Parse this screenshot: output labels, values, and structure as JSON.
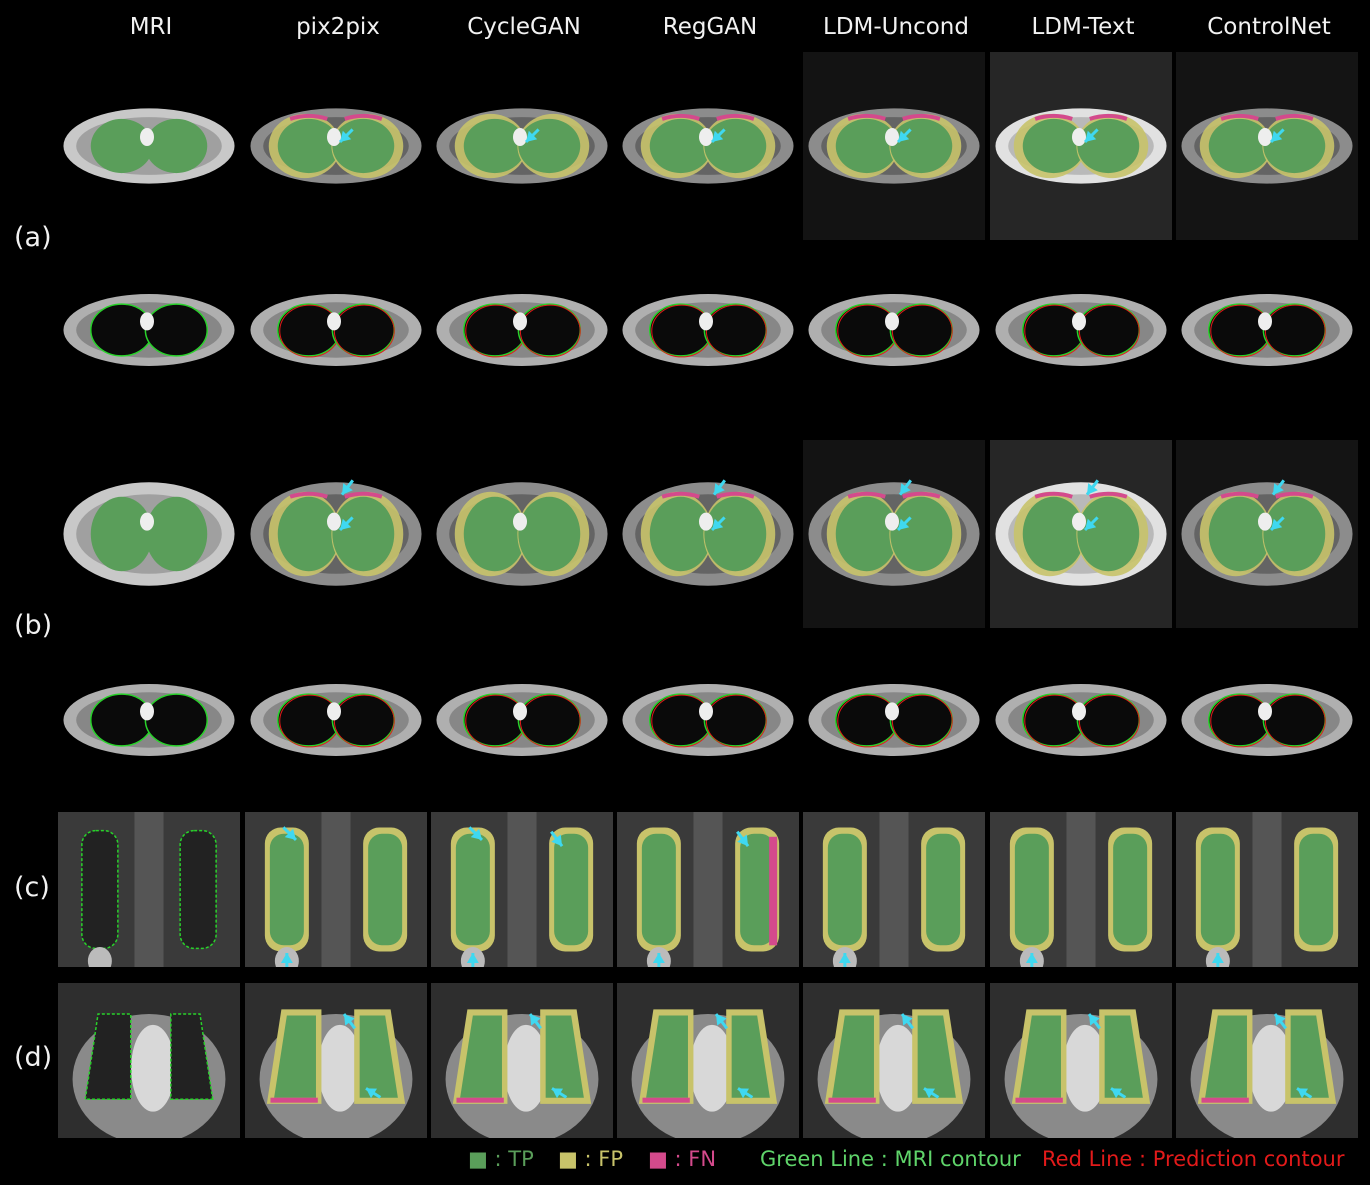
{
  "columns": [
    "MRI",
    "pix2pix",
    "CycleGAN",
    "RegGAN",
    "LDM-Uncond",
    "LDM-Text",
    "ControlNet"
  ],
  "row_labels": {
    "a": "(a)",
    "b": "(b)",
    "c": "(c)",
    "d": "(d)"
  },
  "legend": {
    "tp": "■ : TP",
    "fp": "■ : FP",
    "fn": "■ : FN",
    "green_line": "Green Line : MRI contour",
    "red_line": "Red Line : Prediction contour"
  },
  "colors": {
    "tp": "#5a9e5a",
    "fp": "#c8c36a",
    "fn": "#d44a8c",
    "mri_contour": "#28d22a",
    "pred_contour": "#e21a1a",
    "arrow": "#3fd8f0",
    "text": "#f2f2f2"
  }
}
